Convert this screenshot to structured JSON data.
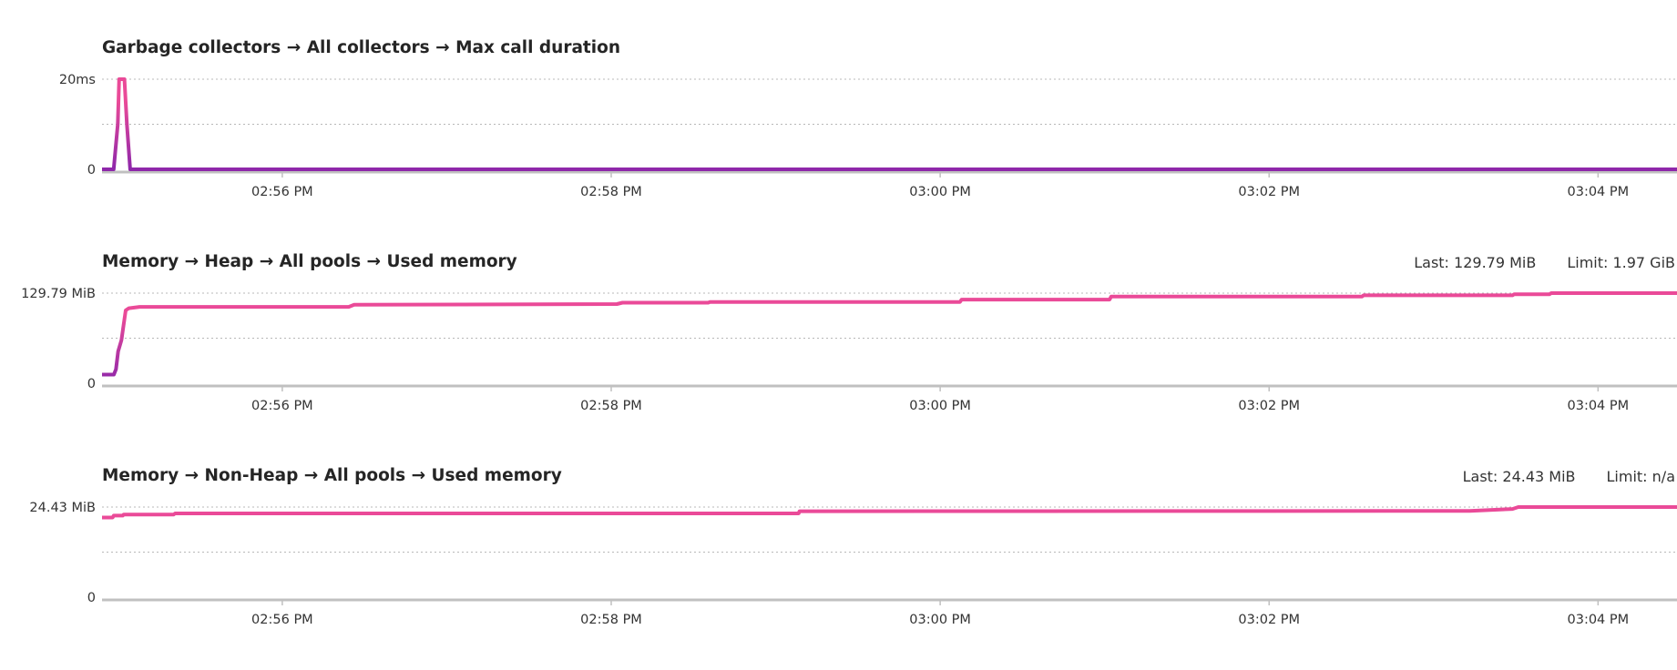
{
  "colors": {
    "line_top": "#ea4a98",
    "line_bottom": "#8e27aa",
    "grid": "#b8b8b8",
    "axis": "#c0c0c0"
  },
  "chart_data": [
    {
      "type": "line",
      "title": "Garbage collectors → All collectors → Max call duration",
      "x_unit": "minutes after 02:54 PM",
      "xlim": [
        0.904,
        10.48
      ],
      "ylim": [
        0,
        20
      ],
      "y_ticks": [
        {
          "value": 20,
          "label": "20ms"
        },
        {
          "value": 10,
          "label": ""
        },
        {
          "value": 0,
          "label": "0"
        }
      ],
      "x_ticks": [
        {
          "value": 2,
          "label": "02:56 PM"
        },
        {
          "value": 4,
          "label": "02:58 PM"
        },
        {
          "value": 6,
          "label": "03:00 PM"
        },
        {
          "value": 8,
          "label": "03:02 PM"
        },
        {
          "value": 10,
          "label": "03:04 PM"
        }
      ],
      "grid": true,
      "points": [
        [
          0.904,
          0
        ],
        [
          0.975,
          0
        ],
        [
          1.0,
          10
        ],
        [
          1.008,
          20
        ],
        [
          1.04,
          20
        ],
        [
          1.055,
          10
        ],
        [
          1.075,
          0
        ],
        [
          10.48,
          0
        ]
      ]
    },
    {
      "type": "line",
      "title": "Memory → Heap → All pools → Used memory",
      "last": "Last: 129.79 MiB",
      "limit": "Limit: 1.97 GiB",
      "x_unit": "minutes after 02:54 PM",
      "xlim": [
        0.904,
        10.48
      ],
      "ylim": [
        0,
        129.79
      ],
      "y_ticks": [
        {
          "value": 129.79,
          "label": "129.79 MiB"
        },
        {
          "value": 64.9,
          "label": ""
        },
        {
          "value": 0,
          "label": "0"
        }
      ],
      "x_ticks": [
        {
          "value": 2,
          "label": "02:56 PM"
        },
        {
          "value": 4,
          "label": "02:58 PM"
        },
        {
          "value": 6,
          "label": "03:00 PM"
        },
        {
          "value": 8,
          "label": "03:02 PM"
        },
        {
          "value": 10,
          "label": "03:04 PM"
        }
      ],
      "grid": true,
      "points": [
        [
          0.904,
          12.4
        ],
        [
          0.976,
          12.4
        ],
        [
          0.989,
          20
        ],
        [
          1.002,
          46
        ],
        [
          1.022,
          62
        ],
        [
          1.048,
          105
        ],
        [
          1.067,
          108
        ],
        [
          1.132,
          110
        ],
        [
          2.404,
          110
        ],
        [
          2.437,
          113
        ],
        [
          4.035,
          114
        ],
        [
          4.068,
          116
        ],
        [
          4.59,
          116
        ],
        [
          4.6,
          117
        ],
        [
          6.12,
          117
        ],
        [
          6.13,
          120.5
        ],
        [
          7.03,
          120.5
        ],
        [
          7.04,
          125
        ],
        [
          8.565,
          125
        ],
        [
          8.575,
          126.7
        ],
        [
          9.48,
          126.7
        ],
        [
          9.49,
          128.2
        ],
        [
          9.705,
          128.2
        ],
        [
          9.715,
          129.79
        ],
        [
          10.48,
          129.79
        ]
      ]
    },
    {
      "type": "line",
      "title": "Memory → Non-Heap → All pools → Used memory",
      "last": "Last: 24.43 MiB",
      "limit": "Limit: n/a",
      "x_unit": "minutes after 02:54 PM",
      "xlim": [
        0.904,
        10.48
      ],
      "ylim": [
        0,
        24.43
      ],
      "y_ticks": [
        {
          "value": 24.43,
          "label": "24.43 MiB"
        },
        {
          "value": 12.2,
          "label": ""
        },
        {
          "value": 0,
          "label": "0"
        }
      ],
      "x_ticks": [
        {
          "value": 2,
          "label": "02:56 PM"
        },
        {
          "value": 4,
          "label": "02:58 PM"
        },
        {
          "value": 6,
          "label": "03:00 PM"
        },
        {
          "value": 8,
          "label": "03:02 PM"
        },
        {
          "value": 10,
          "label": "03:04 PM"
        }
      ],
      "grid": true,
      "points": [
        [
          0.904,
          21.6
        ],
        [
          0.969,
          21.6
        ],
        [
          0.975,
          22.1
        ],
        [
          1.03,
          22.1
        ],
        [
          1.035,
          22.4
        ],
        [
          1.34,
          22.4
        ],
        [
          1.348,
          22.7
        ],
        [
          5.14,
          22.7
        ],
        [
          5.144,
          23.3
        ],
        [
          9.22,
          23.4
        ],
        [
          9.48,
          23.9
        ],
        [
          9.515,
          24.43
        ],
        [
          10.48,
          24.43
        ]
      ]
    }
  ]
}
